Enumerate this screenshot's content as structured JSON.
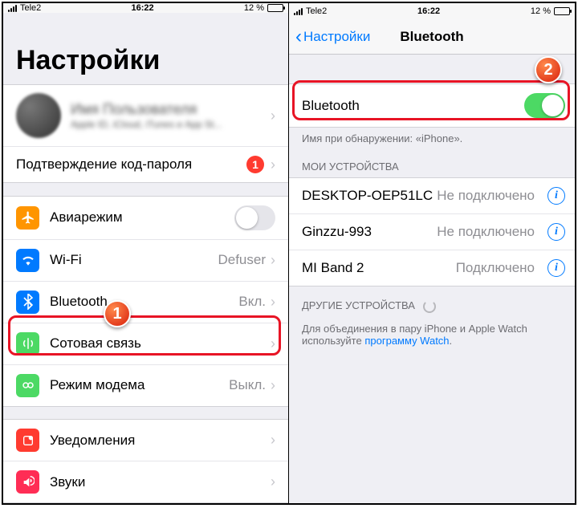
{
  "status": {
    "carrier": "Tele2",
    "time": "16:22",
    "battery": "12 %"
  },
  "left": {
    "title": "Настройки",
    "profile_name": "Имя Пользователя",
    "profile_sub": "Apple ID, iCloud, iTunes и App St...",
    "confirm_label": "Подтверждение код-пароля",
    "confirm_badge": "1",
    "rows": {
      "airplane": "Авиарежим",
      "wifi": "Wi-Fi",
      "wifi_val": "Defuser",
      "bluetooth": "Bluetooth",
      "bluetooth_val": "Вкл.",
      "cellular": "Сотовая связь",
      "hotspot": "Режим модема",
      "hotspot_val": "Выкл.",
      "notifications": "Уведомления",
      "sounds": "Звуки"
    }
  },
  "right": {
    "back": "Настройки",
    "title": "Bluetooth",
    "bt_row": "Bluetooth",
    "discover": "Имя при обнаружении: «iPhone».",
    "my_devices": "МОИ УСТРОЙСТВА",
    "devices": [
      {
        "name": "DESKTOP-OEP51LC",
        "status": "Не подключено"
      },
      {
        "name": "Ginzzu-993",
        "status": "Не подключено"
      },
      {
        "name": "MI Band 2",
        "status": "Подключено"
      }
    ],
    "other_devices": "ДРУГИЕ УСТРОЙСТВА",
    "pair_text_1": "Для объединения в пару iPhone и Apple Watch используйте ",
    "pair_link": "программу Watch",
    "pair_text_2": "."
  },
  "callouts": {
    "one": "1",
    "two": "2"
  }
}
